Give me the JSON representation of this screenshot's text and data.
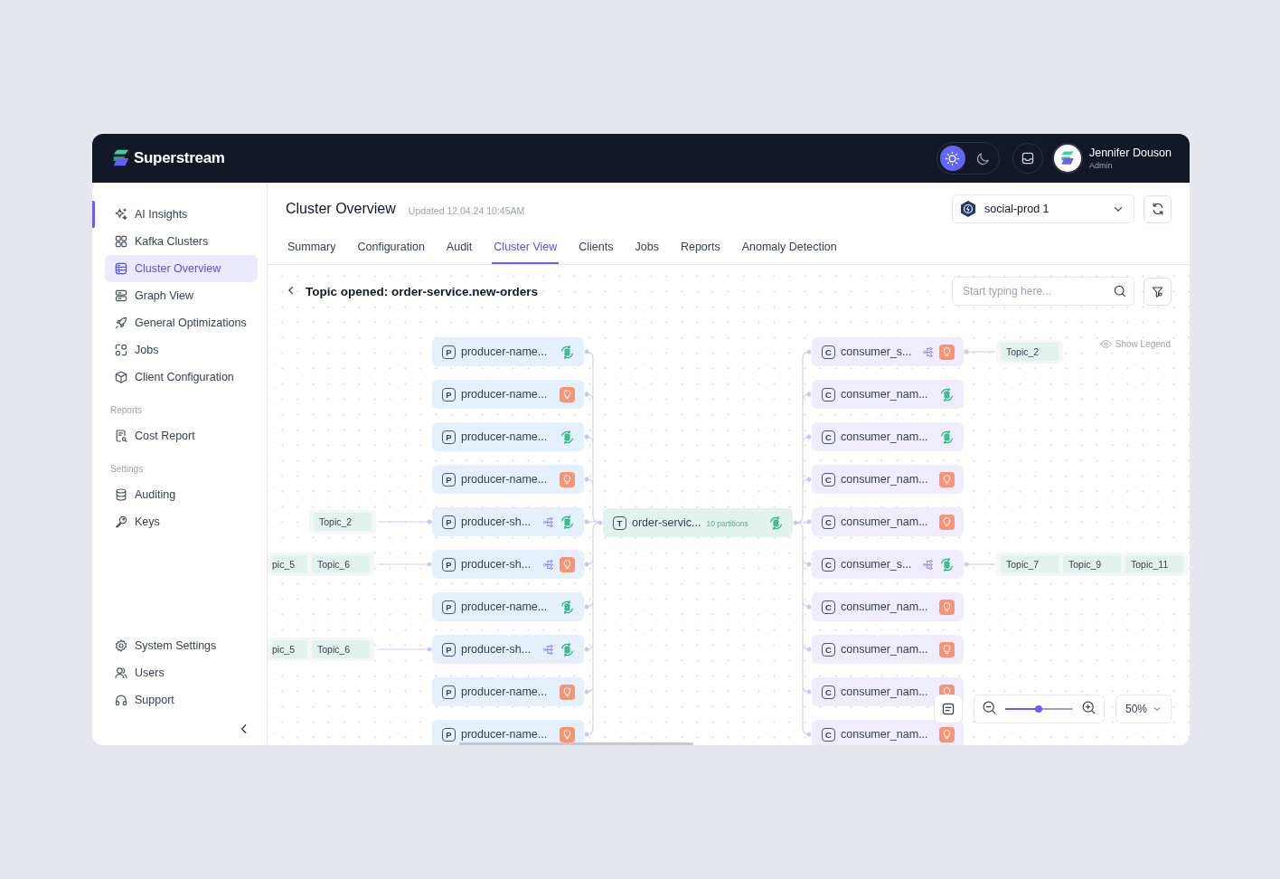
{
  "header": {
    "brand": "Superstream",
    "theme": [
      {
        "kind": "light",
        "selected": true
      },
      {
        "kind": "dark",
        "selected": false
      }
    ],
    "user": {
      "name": "Jennifer Douson",
      "role": "Admin"
    }
  },
  "sidebar": {
    "items": [
      {
        "label": "AI Insights",
        "selected": false
      },
      {
        "label": "Kafka Clusters",
        "selected": false
      },
      {
        "label": "Cluster Overview",
        "selected": true
      },
      {
        "label": "Graph View",
        "selected": false
      },
      {
        "label": "General Optimizations",
        "selected": false
      },
      {
        "label": "Jobs",
        "selected": false
      },
      {
        "label": "Client Configuration",
        "selected": false
      }
    ],
    "sections": [
      {
        "heading": "Reports",
        "items": [
          {
            "label": "Cost Report",
            "selected": false
          }
        ]
      },
      {
        "heading": "Settings",
        "items": [
          {
            "label": "Auditing",
            "selected": false
          },
          {
            "label": "Keys",
            "selected": false
          }
        ]
      }
    ],
    "bottom_items": [
      {
        "label": "System Settings",
        "selected": false
      },
      {
        "label": "Users",
        "selected": false
      },
      {
        "label": "Support",
        "selected": false
      }
    ]
  },
  "page": {
    "title": "Cluster Overview",
    "updated": "Updated 12.04.24 10:45AM",
    "cluster_select": {
      "value": "social-prod 1"
    }
  },
  "tabs": [
    {
      "label": "Summary",
      "selected": false
    },
    {
      "label": "Configuration",
      "selected": false
    },
    {
      "label": "Audit",
      "selected": false
    },
    {
      "label": "Cluster View",
      "selected": true
    },
    {
      "label": "Clients",
      "selected": false
    },
    {
      "label": "Jobs",
      "selected": false
    },
    {
      "label": "Reports",
      "selected": false
    },
    {
      "label": "Anomaly Detection",
      "selected": false
    }
  ],
  "topic_bar": {
    "title": "Topic opened: order-service.new-orders",
    "search": {
      "placeholder": "Start typing here..."
    }
  },
  "graph": {
    "legend_toggle": "Show Legend",
    "topic": {
      "letter": "T",
      "name": "order-servic...",
      "partitions": "10 partitions",
      "badge": {
        "kind": "ai"
      }
    },
    "producers": [
      {
        "letter": "P",
        "name": "producer-name...",
        "shared": false,
        "badge": {
          "kind": "ai"
        }
      },
      {
        "letter": "P",
        "name": "producer-name...",
        "shared": false,
        "badge": {
          "kind": "insight"
        }
      },
      {
        "letter": "P",
        "name": "producer-name...",
        "shared": false,
        "badge": {
          "kind": "ai"
        }
      },
      {
        "letter": "P",
        "name": "producer-name...",
        "shared": false,
        "badge": {
          "kind": "insight"
        }
      },
      {
        "letter": "P",
        "name": "producer-sh...",
        "shared": true,
        "badge": {
          "kind": "ai"
        },
        "inputs": [
          "Topic_2"
        ]
      },
      {
        "letter": "P",
        "name": "producer-sh...",
        "shared": true,
        "badge": {
          "kind": "insight"
        },
        "inputs": [
          "pic_5",
          "Topic_6"
        ]
      },
      {
        "letter": "P",
        "name": "producer-name...",
        "shared": false,
        "badge": {
          "kind": "ai"
        }
      },
      {
        "letter": "P",
        "name": "producer-sh...",
        "shared": true,
        "badge": {
          "kind": "ai"
        },
        "inputs": [
          "pic_5",
          "Topic_6"
        ]
      },
      {
        "letter": "P",
        "name": "producer-name...",
        "shared": false,
        "badge": {
          "kind": "insight"
        }
      },
      {
        "letter": "P",
        "name": "producer-name...",
        "shared": false,
        "badge": {
          "kind": "insight"
        }
      }
    ],
    "consumers": [
      {
        "letter": "C",
        "name": "consumer_s...",
        "shared": true,
        "badge": {
          "kind": "insight"
        },
        "outputs": [
          "Topic_2"
        ]
      },
      {
        "letter": "C",
        "name": "consumer_nam...",
        "shared": false,
        "badge": {
          "kind": "ai"
        }
      },
      {
        "letter": "C",
        "name": "consumer_nam...",
        "shared": false,
        "badge": {
          "kind": "ai"
        }
      },
      {
        "letter": "C",
        "name": "consumer_nam...",
        "shared": false,
        "badge": {
          "kind": "insight"
        }
      },
      {
        "letter": "C",
        "name": "consumer_nam...",
        "shared": false,
        "badge": {
          "kind": "insight"
        }
      },
      {
        "letter": "C",
        "name": "consumer_s...",
        "shared": true,
        "badge": {
          "kind": "ai"
        },
        "outputs": [
          "Topic_7",
          "Topic_9",
          "Topic_11"
        ]
      },
      {
        "letter": "C",
        "name": "consumer_nam...",
        "shared": false,
        "badge": {
          "kind": "insight"
        }
      },
      {
        "letter": "C",
        "name": "consumer_nam...",
        "shared": false,
        "badge": {
          "kind": "insight"
        }
      },
      {
        "letter": "C",
        "name": "consumer_nam...",
        "shared": false,
        "badge": {
          "kind": "insight"
        }
      },
      {
        "letter": "C",
        "name": "consumer_nam...",
        "shared": false,
        "badge": {
          "kind": "insight"
        }
      }
    ]
  },
  "zoom": {
    "level": 0.5,
    "value": "50%"
  }
}
